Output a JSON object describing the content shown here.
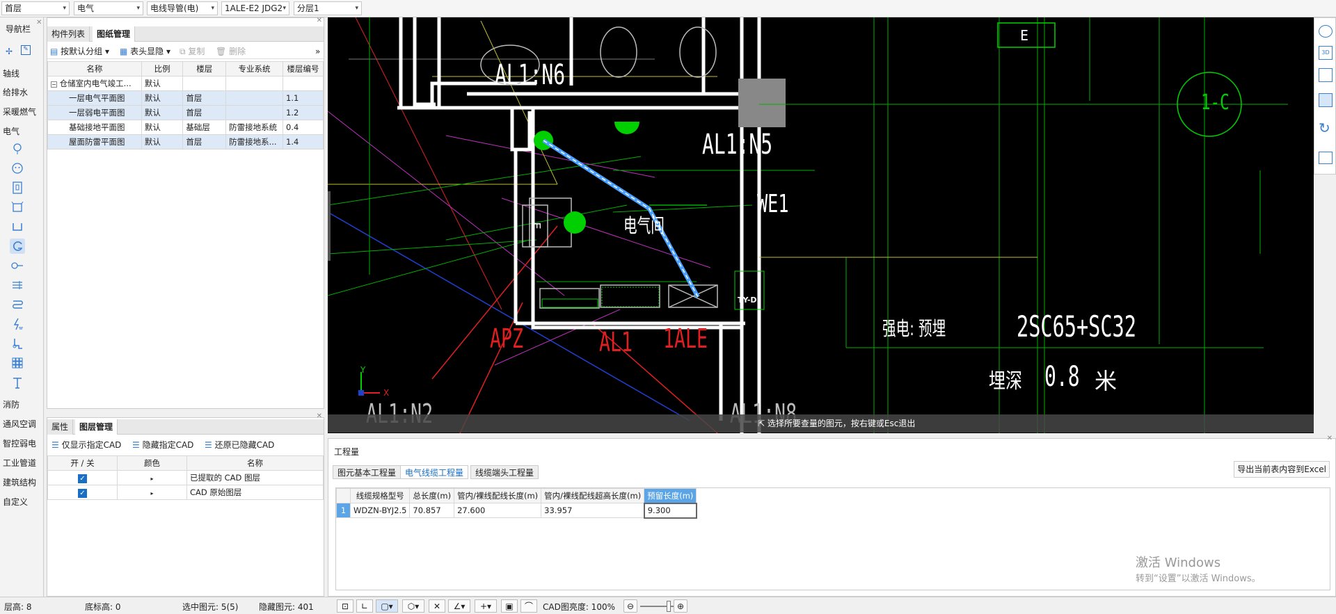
{
  "topbar": {
    "floor": "首层",
    "discipline": "电气",
    "category": "电线导管(电)",
    "type": "1ALE-E2 JDG2",
    "layer": "分层1"
  },
  "nav": {
    "title": "导航栏",
    "items": [
      "轴线",
      "给排水",
      "采暖燃气",
      "电气",
      "消防",
      "通风空调",
      "智控弱电",
      "工业管道",
      "建筑结构",
      "自定义"
    ]
  },
  "left": {
    "tabs": [
      "构件列表",
      "图纸管理"
    ],
    "toolbar": {
      "group": "按默认分组",
      "header": "表头显隐",
      "copy": "复制",
      "delete": "删除"
    },
    "columns": [
      "名称",
      "比例",
      "楼层",
      "专业系统",
      "楼层编号"
    ],
    "rows": [
      {
        "name": "仓储室内电气竣工...",
        "scale": "默认",
        "floor": "",
        "system": "",
        "num": ""
      },
      {
        "name": "一层电气平面图",
        "scale": "默认",
        "floor": "首层",
        "system": "",
        "num": "1.1"
      },
      {
        "name": "一层弱电平面图",
        "scale": "默认",
        "floor": "首层",
        "system": "",
        "num": "1.2"
      },
      {
        "name": "基础接地平面图",
        "scale": "默认",
        "floor": "基础层",
        "system": "防雷接地系统",
        "num": "0.4"
      },
      {
        "name": "屋面防雷平面图",
        "scale": "默认",
        "floor": "首层",
        "system": "防雷接地系...",
        "num": "1.4"
      }
    ]
  },
  "layers": {
    "tabs": [
      "属性",
      "图层管理"
    ],
    "toolbar": {
      "show_only": "仅显示指定CAD",
      "hide": "隐藏指定CAD",
      "restore": "还原已隐藏CAD"
    },
    "columns": [
      "开 / 关",
      "颜色",
      "名称"
    ],
    "rows": [
      {
        "name": "已提取的 CAD 图层"
      },
      {
        "name": "CAD 原始图层"
      }
    ]
  },
  "canvas": {
    "labels": [
      "AL1:N6",
      "AL1:N5",
      "WE1",
      "电气间",
      "APZ",
      "AL1",
      "1ALE",
      "AL1:N2",
      "AL1:N8",
      "1-C",
      "强电: 预埋",
      "2SC65+SC32",
      "埋深",
      "0.8",
      "米",
      "TY-D",
      "E",
      "Ε"
    ],
    "status_msg": "选择所要查量的图元，按右键或Esc退出"
  },
  "quantity": {
    "title": "工程量",
    "tabs": [
      "图元基本工程量",
      "电气线缆工程量",
      "线缆端头工程量"
    ],
    "export": "导出当前表内容到Excel",
    "columns": [
      "线缆规格型号",
      "总长度(m)",
      "管内/裸线配线长度(m)",
      "管内/裸线配线超高长度(m)",
      "预留长度(m)"
    ],
    "rows": [
      {
        "idx": "1",
        "spec": "WDZN-BYJ2.5",
        "total": "70.857",
        "inner": "27.600",
        "over": "33.957",
        "reserve": "9.300"
      }
    ]
  },
  "watermark": {
    "line1": "激活 Windows",
    "line2": "转到“设置”以激活 Windows。"
  },
  "status": {
    "floor_h": "层高: 8",
    "base_h": "底标高: 0",
    "selected": "选中图元: 5(5)",
    "hidden": "隐藏图元: 401",
    "brightness": "CAD图亮度: 100%"
  },
  "colors": {
    "selection": "#dde9f7",
    "accent": "#1a6fc4",
    "cad_green": "#00d000",
    "cad_red": "#e02020"
  }
}
